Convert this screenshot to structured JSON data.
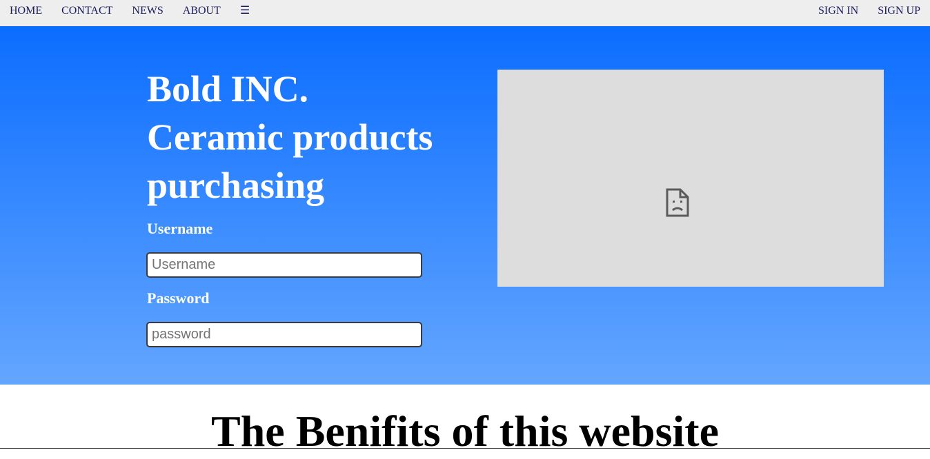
{
  "nav": {
    "left": [
      {
        "label": "HOME"
      },
      {
        "label": "CONTACT"
      },
      {
        "label": "NEWS"
      },
      {
        "label": "ABOUT"
      },
      {
        "label": "☰"
      }
    ],
    "right": [
      {
        "label": "SIGN IN"
      },
      {
        "label": "SIGN UP"
      }
    ]
  },
  "hero": {
    "title_lines": [
      "Bold INC.",
      "Ceramic products",
      "purchasing"
    ],
    "username_label": "Username",
    "username_placeholder": "Username",
    "password_label": "Password",
    "password_placeholder": "password",
    "image_icon": "broken-image-icon"
  },
  "benefits": {
    "title": "The Benifits of this website"
  },
  "colors": {
    "hero_top": "#0b6dff",
    "hero_bottom": "#64a6ff",
    "nav_bg": "#eeeeee",
    "nav_text": "#1a1a5e",
    "image_placeholder_bg": "#dddddd"
  }
}
